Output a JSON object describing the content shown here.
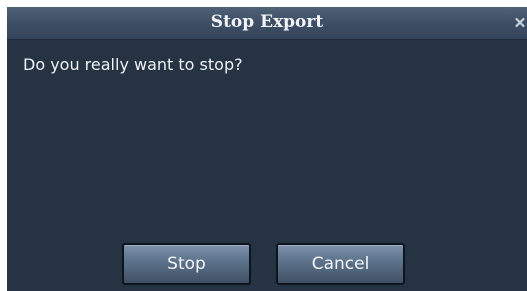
{
  "dialog": {
    "title": "Stop Export",
    "close_icon": "close-icon",
    "message": "Do you really want to stop?",
    "buttons": {
      "stop_label": "Stop",
      "cancel_label": "Cancel"
    }
  },
  "colors": {
    "body_bg": "#263343",
    "title_bg": "#3f5067",
    "button_bg": "#657a93",
    "text": "#eef1f5"
  }
}
